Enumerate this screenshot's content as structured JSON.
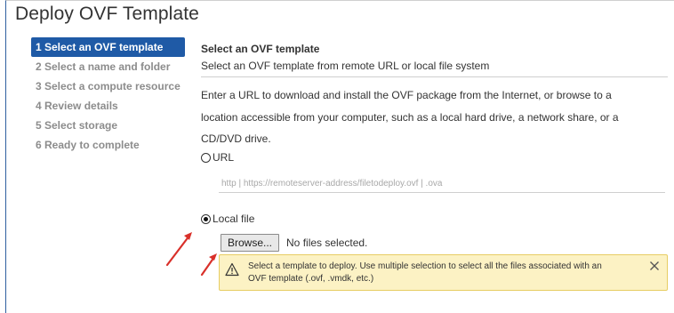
{
  "window": {
    "title": "Deploy OVF Template"
  },
  "wizard_nav": {
    "items": [
      {
        "label": "1 Select an OVF template",
        "active": true
      },
      {
        "label": "2 Select a name and folder",
        "active": false
      },
      {
        "label": "3 Select a compute resource",
        "active": false
      },
      {
        "label": "4 Review details",
        "active": false
      },
      {
        "label": "5 Select storage",
        "active": false
      },
      {
        "label": "6 Ready to complete",
        "active": false
      }
    ]
  },
  "step": {
    "title": "Select an OVF template",
    "subtitle": "Select an OVF template from remote URL or local file system",
    "description_lines": [
      "Enter a URL to download and install the OVF package from the Internet, or browse to a",
      "location accessible from your computer, such as a local hard drive, a network share, or a",
      "CD/DVD drive."
    ]
  },
  "source": {
    "url_label": "URL",
    "url_selected": false,
    "url_placeholder": "http | https://remoteserver-address/filetodeploy.ovf | .ova",
    "local_label": "Local file",
    "local_selected": true,
    "browse_label": "Browse...",
    "file_status": "No files selected."
  },
  "alert": {
    "icon": "warning-icon",
    "lines": [
      "Select a template to deploy. Use multiple selection to select all the files associated with an",
      "OVF template (.ovf, .vmdk, etc.)"
    ]
  },
  "colors": {
    "active_step_bg": "#1f5aa6",
    "alert_bg": "#fcf2c4",
    "alert_border": "#e7cd63",
    "annotation_arrow": "#d9302a"
  }
}
